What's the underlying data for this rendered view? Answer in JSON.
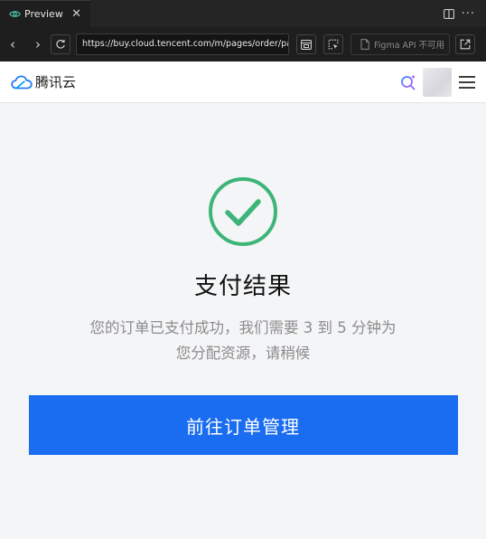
{
  "editor": {
    "tab_label": "Preview",
    "tab_close": "✕",
    "more": "···"
  },
  "browser": {
    "back": "‹",
    "forward": "›",
    "url": "https://buy.cloud.tencent.com/m/pages/order/pay",
    "figma_label": "Figma API 不可用"
  },
  "site": {
    "logo_text": "腾讯云"
  },
  "result": {
    "title": "支付结果",
    "description_line1": "您的订单已支付成功，我们需要 3 到 5 分钟为",
    "description_line2": "您分配资源，请稍候",
    "button_label": "前往订单管理"
  },
  "colors": {
    "accent": "#1a6cf0",
    "success": "#3db579"
  }
}
